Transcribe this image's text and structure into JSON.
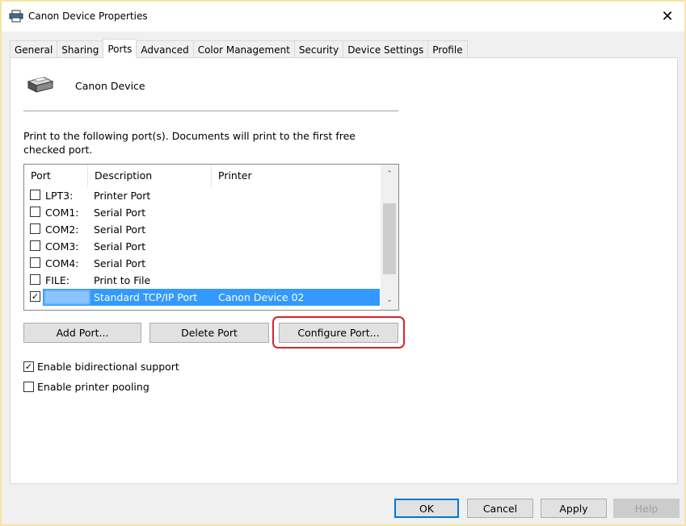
{
  "window": {
    "title": "Canon Device Properties",
    "close_glyph": "✕"
  },
  "tabs": [
    {
      "label": "General"
    },
    {
      "label": "Sharing"
    },
    {
      "label": "Ports"
    },
    {
      "label": "Advanced"
    },
    {
      "label": "Color Management"
    },
    {
      "label": "Security"
    },
    {
      "label": "Device Settings"
    },
    {
      "label": "Profile"
    }
  ],
  "active_tab": "Ports",
  "device": {
    "name": "Canon Device",
    "icon": "printer-icon"
  },
  "instructions": "Print to the following port(s). Documents will print to the first free checked port.",
  "port_list": {
    "columns": {
      "port": "Port",
      "description": "Description",
      "printer": "Printer"
    },
    "rows": [
      {
        "port": "LPT3:",
        "description": "Printer Port",
        "printer": "",
        "checked": false
      },
      {
        "port": "COM1:",
        "description": "Serial Port",
        "printer": "",
        "checked": false
      },
      {
        "port": "COM2:",
        "description": "Serial Port",
        "printer": "",
        "checked": false
      },
      {
        "port": "COM3:",
        "description": "Serial Port",
        "printer": "",
        "checked": false
      },
      {
        "port": "COM4:",
        "description": "Serial Port",
        "printer": "",
        "checked": false
      },
      {
        "port": "FILE:",
        "description": "Print to File",
        "printer": "",
        "checked": false
      },
      {
        "port": "",
        "description": "Standard TCP/IP Port",
        "printer": "Canon Device 02",
        "checked": true,
        "selected": true
      }
    ],
    "scroll_up_glyph": "⌃",
    "scroll_down_glyph": "⌄"
  },
  "port_buttons": {
    "add": "Add Port...",
    "delete": "Delete Port",
    "configure": "Configure Port..."
  },
  "options": {
    "bidirectional": {
      "label": "Enable bidirectional support",
      "checked": true
    },
    "pooling": {
      "label": "Enable printer pooling",
      "checked": false
    }
  },
  "dialog_buttons": {
    "ok": "OK",
    "cancel": "Cancel",
    "apply": "Apply",
    "help": "Help"
  },
  "check_glyph": "✓",
  "colors": {
    "selection": "#3399ff",
    "highlight_ring": "#d9252b",
    "default_button": "#0078d7"
  }
}
